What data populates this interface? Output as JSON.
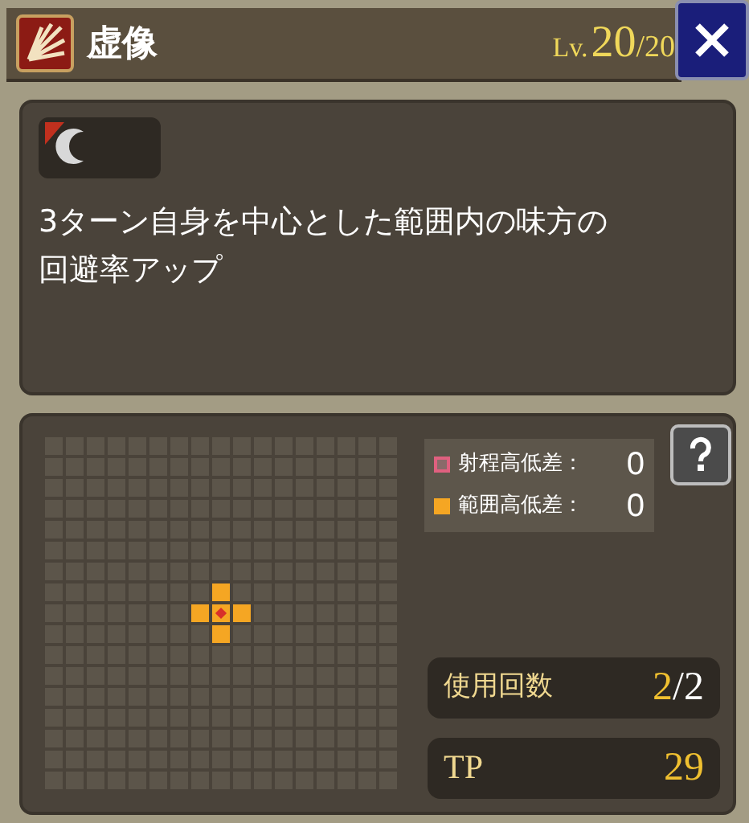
{
  "header": {
    "title": "虚像",
    "level_prefix": "Lv.",
    "level": "20",
    "level_max": "/20"
  },
  "description": {
    "text": "3ターン自身を中心とした範囲内の味方の回避率アップ"
  },
  "range_grid": {
    "origin_marked": true,
    "rows": [
      [
        false,
        false,
        false,
        false,
        false,
        false,
        false,
        false,
        false,
        false,
        false,
        false,
        false,
        false,
        false,
        false,
        false
      ],
      [
        false,
        false,
        false,
        false,
        false,
        false,
        false,
        false,
        false,
        false,
        false,
        false,
        false,
        false,
        false,
        false,
        false
      ],
      [
        false,
        false,
        false,
        false,
        false,
        false,
        false,
        false,
        false,
        false,
        false,
        false,
        false,
        false,
        false,
        false,
        false
      ],
      [
        false,
        false,
        false,
        false,
        false,
        false,
        false,
        false,
        false,
        false,
        false,
        false,
        false,
        false,
        false,
        false,
        false
      ],
      [
        false,
        false,
        false,
        false,
        false,
        false,
        false,
        false,
        false,
        false,
        false,
        false,
        false,
        false,
        false,
        false,
        false
      ],
      [
        false,
        false,
        false,
        false,
        false,
        false,
        false,
        false,
        false,
        false,
        false,
        false,
        false,
        false,
        false,
        false,
        false
      ],
      [
        false,
        false,
        false,
        false,
        false,
        false,
        false,
        false,
        false,
        false,
        false,
        false,
        false,
        false,
        false,
        false,
        false
      ],
      [
        false,
        false,
        false,
        false,
        false,
        false,
        false,
        false,
        true,
        false,
        false,
        false,
        false,
        false,
        false,
        false,
        false
      ],
      [
        false,
        false,
        false,
        false,
        false,
        false,
        false,
        true,
        true,
        true,
        false,
        false,
        false,
        false,
        false,
        false,
        false
      ],
      [
        false,
        false,
        false,
        false,
        false,
        false,
        false,
        false,
        true,
        false,
        false,
        false,
        false,
        false,
        false,
        false,
        false
      ],
      [
        false,
        false,
        false,
        false,
        false,
        false,
        false,
        false,
        false,
        false,
        false,
        false,
        false,
        false,
        false,
        false,
        false
      ],
      [
        false,
        false,
        false,
        false,
        false,
        false,
        false,
        false,
        false,
        false,
        false,
        false,
        false,
        false,
        false,
        false,
        false
      ],
      [
        false,
        false,
        false,
        false,
        false,
        false,
        false,
        false,
        false,
        false,
        false,
        false,
        false,
        false,
        false,
        false,
        false
      ],
      [
        false,
        false,
        false,
        false,
        false,
        false,
        false,
        false,
        false,
        false,
        false,
        false,
        false,
        false,
        false,
        false,
        false
      ],
      [
        false,
        false,
        false,
        false,
        false,
        false,
        false,
        false,
        false,
        false,
        false,
        false,
        false,
        false,
        false,
        false,
        false
      ],
      [
        false,
        false,
        false,
        false,
        false,
        false,
        false,
        false,
        false,
        false,
        false,
        false,
        false,
        false,
        false,
        false,
        false
      ],
      [
        false,
        false,
        false,
        false,
        false,
        false,
        false,
        false,
        false,
        false,
        false,
        false,
        false,
        false,
        false,
        false,
        false
      ]
    ]
  },
  "legend": [
    {
      "label": "射程高低差：",
      "value": "0",
      "color": "#e0607f",
      "kind": "outline"
    },
    {
      "label": "範囲高低差：",
      "value": "0",
      "color": "#f5a623",
      "kind": "filled"
    }
  ],
  "stats": [
    {
      "label": "使用回数",
      "value": "2",
      "max": "/2"
    },
    {
      "label": "TP",
      "value": "29"
    }
  ]
}
